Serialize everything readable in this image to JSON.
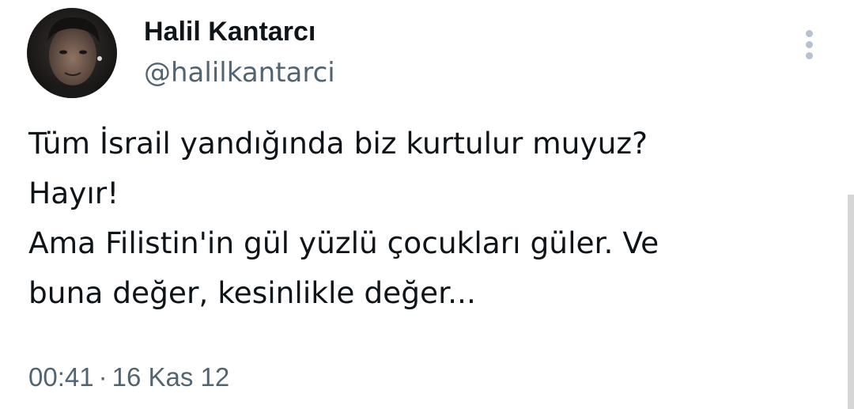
{
  "author": {
    "display_name": "Halil Kantarcı",
    "handle": "@halilkantarci",
    "avatar": "profile-photo"
  },
  "menu": {
    "icon": "more-vertical-icon"
  },
  "tweet": {
    "lines": [
      "Tüm İsrail yandığında biz kurtulur muyuz?",
      "Hayır!",
      "Ama Filistin'in gül yüzlü çocukları güler. Ve",
      "buna değer, kesinlikle değer..."
    ]
  },
  "meta": {
    "time": "00:41",
    "separator": "·",
    "date": "16 Kas 12"
  },
  "colors": {
    "text_primary": "#0f1419",
    "text_secondary": "#536471",
    "menu_dots": "#b7c2cc"
  }
}
